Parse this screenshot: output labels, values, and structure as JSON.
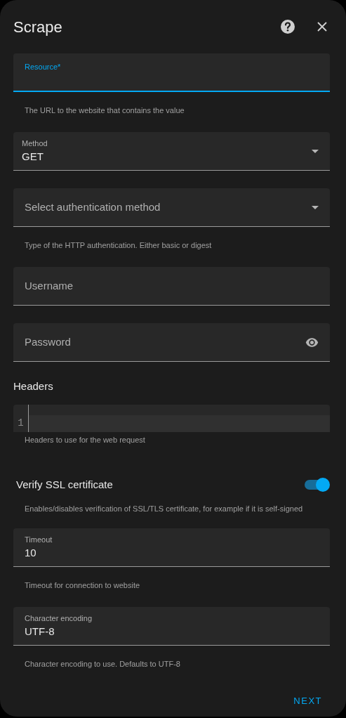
{
  "dialog": {
    "title": "Scrape"
  },
  "fields": [
    {
      "kind": "text",
      "label": "Resource*",
      "focused": true,
      "helper": "The URL to the website that contains the value"
    },
    {
      "kind": "select",
      "label": "Method",
      "value": "GET"
    },
    {
      "kind": "select",
      "placeholder": "Select authentication method",
      "helper": "Type of the HTTP authentication. Either basic or digest"
    },
    {
      "kind": "text",
      "placeholder": "Username"
    },
    {
      "kind": "password",
      "placeholder": "Password"
    },
    {
      "kind": "code",
      "label": "Headers",
      "line_numbers": [
        "1"
      ],
      "helper": "Headers to use for the web request"
    },
    {
      "kind": "toggle",
      "label": "Verify SSL certificate",
      "on": true,
      "helper": "Enables/disables verification of SSL/TLS certificate, for example if it is self-signed"
    },
    {
      "kind": "text",
      "label": "Timeout",
      "value": "10",
      "helper": "Timeout for connection to website"
    },
    {
      "kind": "text",
      "label": "Character encoding",
      "value": "UTF-8",
      "helper": "Character encoding to use. Defaults to UTF-8"
    }
  ],
  "actions": [
    {
      "label": "NEXT"
    }
  ]
}
